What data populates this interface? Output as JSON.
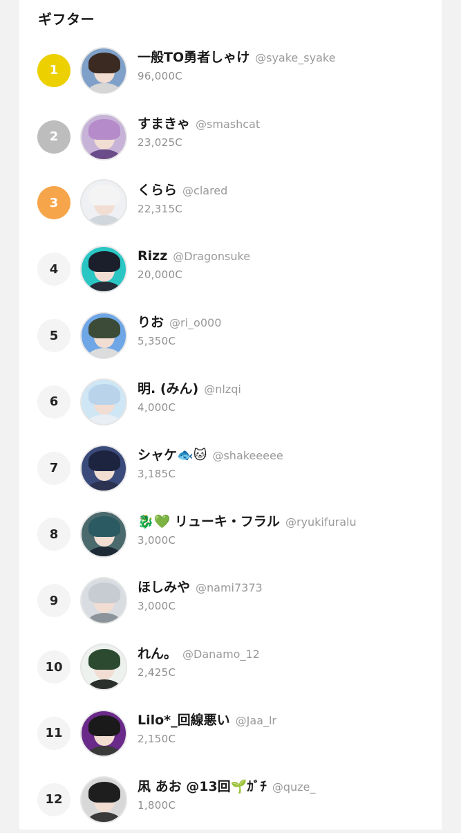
{
  "section": {
    "title": "ギフター"
  },
  "gifters": [
    {
      "rank": "1",
      "name": "一般TO勇者しゃけ",
      "handle": "@syake_syake",
      "amount": "96,000C",
      "rank_style": "gold",
      "avatar": {
        "bg": "#7fa0c8",
        "hair": "#3a2a22",
        "body": "#d6d6d6"
      }
    },
    {
      "rank": "2",
      "name": "すまきゃ",
      "handle": "@smashcat",
      "amount": "23,025C",
      "rank_style": "silver",
      "avatar": {
        "bg": "#c8b3d8",
        "hair": "#b58bc9",
        "body": "#6b4c8a"
      }
    },
    {
      "rank": "3",
      "name": "くらら",
      "handle": "@clared",
      "amount": "22,315C",
      "rank_style": "bronze",
      "avatar": {
        "bg": "#eef0f4",
        "hair": "#f4f4f4",
        "body": "#cfd6dc"
      }
    },
    {
      "rank": "4",
      "name": "Rizz",
      "handle": "@Dragonsuke",
      "amount": "20,000C",
      "rank_style": "plain",
      "avatar": {
        "bg": "#2ac6c4",
        "hair": "#1a1f2b",
        "body": "#262b38"
      }
    },
    {
      "rank": "5",
      "name": "りお",
      "handle": "@ri_o000",
      "amount": "5,350C",
      "rank_style": "plain",
      "avatar": {
        "bg": "#6fa6e6",
        "hair": "#3c4a38",
        "body": "#dcdcdc"
      }
    },
    {
      "rank": "6",
      "name": "明. (みん)",
      "handle": "@nlzqi",
      "amount": "4,000C",
      "rank_style": "plain",
      "avatar": {
        "bg": "#cfe6f4",
        "hair": "#b9d3ea",
        "body": "#e8eef4"
      }
    },
    {
      "rank": "7",
      "name": "シャケ🐟🐱",
      "handle": "@shakeeeee",
      "amount": "3,185C",
      "rank_style": "plain",
      "avatar": {
        "bg": "#3a4a7a",
        "hair": "#1c2440",
        "body": "#2b3350"
      }
    },
    {
      "rank": "8",
      "name": "🐉💚 リューキ・フラル",
      "handle": "@ryukifuralu",
      "amount": "3,000C",
      "rank_style": "plain",
      "avatar": {
        "bg": "#4a6a6e",
        "hair": "#2b5a62",
        "body": "#1e2a36"
      }
    },
    {
      "rank": "9",
      "name": "ほしみや",
      "handle": "@nami7373",
      "amount": "3,000C",
      "rank_style": "plain",
      "avatar": {
        "bg": "#d9dde2",
        "hair": "#c7ccd2",
        "body": "#8c939b"
      }
    },
    {
      "rank": "10",
      "name": "れん。",
      "handle": "@Danamo_12",
      "amount": "2,425C",
      "rank_style": "plain",
      "avatar": {
        "bg": "#eef2ee",
        "hair": "#2c4a30",
        "body": "#2a2f2b"
      }
    },
    {
      "rank": "11",
      "name": "Lilo*_回線悪い",
      "handle": "@Jaa_lr",
      "amount": "2,150C",
      "rank_style": "plain",
      "avatar": {
        "bg": "#6a2a8a",
        "hair": "#1a1a1a",
        "body": "#3a3a3a"
      }
    },
    {
      "rank": "12",
      "name": "凩 あお @13回🌱ｶﾞﾁ",
      "handle": "@quze_",
      "amount": "1,800C",
      "rank_style": "plain",
      "avatar": {
        "bg": "#d8d8d8",
        "hair": "#1e1e1e",
        "body": "#3a3a3a"
      }
    }
  ]
}
